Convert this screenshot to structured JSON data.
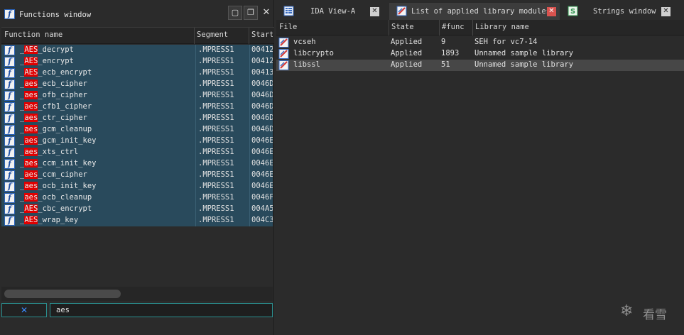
{
  "functions_window": {
    "title": "Functions window",
    "columns": [
      "Function name",
      "Segment",
      "Start"
    ],
    "rows": [
      {
        "pre": "_",
        "hl": "AES",
        "post": "_decrypt",
        "segment": ".MPRESS1",
        "start": "00412"
      },
      {
        "pre": "_",
        "hl": "AES",
        "post": "_encrypt",
        "segment": ".MPRESS1",
        "start": "00412"
      },
      {
        "pre": "_",
        "hl": "AES",
        "post": "_ecb_encrypt",
        "segment": ".MPRESS1",
        "start": "00413"
      },
      {
        "pre": "_",
        "hl": "aes",
        "post": "_ecb_cipher",
        "segment": ".MPRESS1",
        "start": "0046D"
      },
      {
        "pre": "_",
        "hl": "aes",
        "post": "_ofb_cipher",
        "segment": ".MPRESS1",
        "start": "0046D"
      },
      {
        "pre": "_",
        "hl": "aes",
        "post": "_cfb1_cipher",
        "segment": ".MPRESS1",
        "start": "0046D"
      },
      {
        "pre": "_",
        "hl": "aes",
        "post": "_ctr_cipher",
        "segment": ".MPRESS1",
        "start": "0046D"
      },
      {
        "pre": "_",
        "hl": "aes",
        "post": "_gcm_cleanup",
        "segment": ".MPRESS1",
        "start": "0046D"
      },
      {
        "pre": "_",
        "hl": "aes",
        "post": "_gcm_init_key",
        "segment": ".MPRESS1",
        "start": "0046E"
      },
      {
        "pre": "_",
        "hl": "aes",
        "post": "_xts_ctrl",
        "segment": ".MPRESS1",
        "start": "0046E"
      },
      {
        "pre": "_",
        "hl": "aes",
        "post": "_ccm_init_key",
        "segment": ".MPRESS1",
        "start": "0046E"
      },
      {
        "pre": "_",
        "hl": "aes",
        "post": "_ccm_cipher",
        "segment": ".MPRESS1",
        "start": "0046E"
      },
      {
        "pre": "_",
        "hl": "aes",
        "post": "_ocb_init_key",
        "segment": ".MPRESS1",
        "start": "0046E"
      },
      {
        "pre": "_",
        "hl": "aes",
        "post": "_ocb_cleanup",
        "segment": ".MPRESS1",
        "start": "0046F"
      },
      {
        "pre": "_",
        "hl": "AES",
        "post": "_cbc_encrypt",
        "segment": ".MPRESS1",
        "start": "004A5"
      },
      {
        "pre": "_",
        "hl": "AES",
        "post": "_wrap_key",
        "segment": ".MPRESS1",
        "start": "004C3"
      }
    ],
    "search_value": "aes",
    "clear_icon": "close-x-icon"
  },
  "tabs": [
    {
      "label": "IDA View-A",
      "icon": "ida-view-icon"
    },
    {
      "label": "List of applied library modules",
      "icon": "library-modules-icon"
    },
    {
      "label": "Strings window",
      "icon": "strings-icon"
    }
  ],
  "library_list": {
    "columns": [
      "File",
      "State",
      "#func",
      "Library name"
    ],
    "rows": [
      {
        "file": "vcseh",
        "state": "Applied",
        "nfunc": "9",
        "name": "SEH for vc7-14"
      },
      {
        "file": "libcrypto",
        "state": "Applied",
        "nfunc": "1893",
        "name": "Unnamed sample library"
      },
      {
        "file": "libssl",
        "state": "Applied",
        "nfunc": "51",
        "name": "Unnamed sample library"
      }
    ]
  },
  "watermark": {
    "text": "看雪"
  },
  "colors": {
    "selection": "#294a5c",
    "highlight": "#e00000",
    "accent": "#2a8f8f"
  }
}
